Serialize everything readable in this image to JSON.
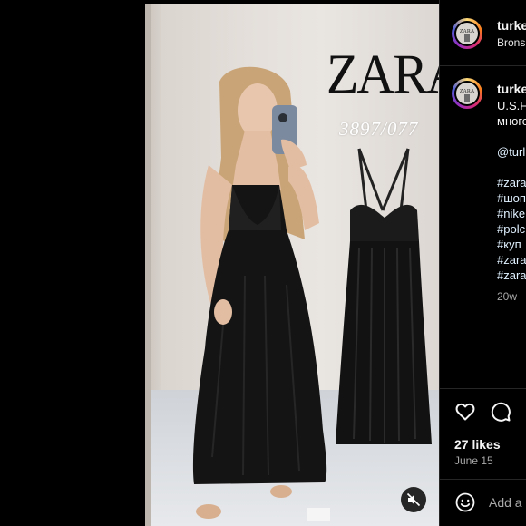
{
  "post": {
    "brand_text": "ZARA",
    "article_code": "3897/077",
    "mute_icon": "speaker-muted-icon"
  },
  "header": {
    "username": "turke",
    "subtitle": "Bronsk"
  },
  "caption": {
    "username": "turke",
    "line1": "U.S.F",
    "line2": "многс",
    "mention": "@turl",
    "hashtags": [
      "#zara",
      "#шоп",
      "#nike",
      "#polc",
      "#куп",
      "#zara",
      "#zara"
    ],
    "age": "20w"
  },
  "actions": {
    "like_icon": "heart-icon",
    "comment_icon": "comment-icon",
    "likes": "27 likes",
    "date": "June 15"
  },
  "comment_box": {
    "emoji_icon": "smiley-icon",
    "placeholder": "Add a c"
  },
  "colors": {
    "background": "#000000",
    "divider": "#262626",
    "hashtag": "#e0f1ff"
  }
}
